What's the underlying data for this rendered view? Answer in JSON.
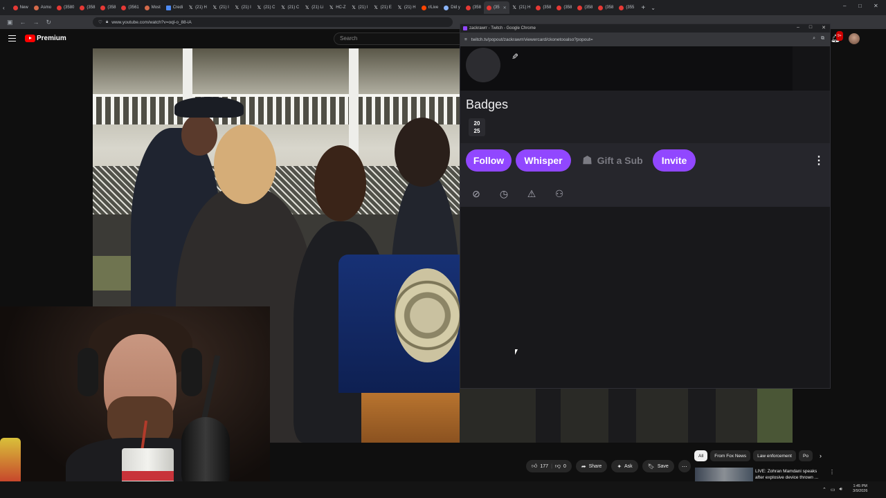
{
  "browser": {
    "tabs": [
      {
        "label": "New",
        "icon": "youtube-icon"
      },
      {
        "label": "Asmo",
        "icon": "channel-icon"
      },
      {
        "label": "(3580",
        "icon": "youtube-icon"
      },
      {
        "label": "(358",
        "icon": "youtube-icon"
      },
      {
        "label": "(358",
        "icon": "youtube-icon"
      },
      {
        "label": "(3561",
        "icon": "youtube-icon"
      },
      {
        "label": "Most",
        "icon": "channel-icon"
      },
      {
        "label": "Credi",
        "icon": "doc-icon"
      },
      {
        "label": "(21) H",
        "icon": "x-icon"
      },
      {
        "label": "(21) I",
        "icon": "x-icon"
      },
      {
        "label": "(21) I",
        "icon": "x-icon"
      },
      {
        "label": "(21) C",
        "icon": "x-icon"
      },
      {
        "label": "(21) C",
        "icon": "x-icon"
      },
      {
        "label": "(21) Li",
        "icon": "x-icon"
      },
      {
        "label": "HC-Z",
        "icon": "x-icon"
      },
      {
        "label": "(21) I",
        "icon": "x-icon"
      },
      {
        "label": "(21) E",
        "icon": "x-icon"
      },
      {
        "label": "(21) H",
        "icon": "x-icon"
      },
      {
        "label": "r/Live",
        "icon": "reddit-icon"
      },
      {
        "label": "Did y",
        "icon": "globe-icon"
      },
      {
        "label": "(358",
        "icon": "youtube-icon"
      },
      {
        "label": "(35",
        "icon": "youtube-icon",
        "active": true
      },
      {
        "label": "(21) H",
        "icon": "x-icon"
      },
      {
        "label": "(358",
        "icon": "youtube-icon"
      },
      {
        "label": "(358",
        "icon": "youtube-icon"
      },
      {
        "label": "(358",
        "icon": "youtube-icon"
      },
      {
        "label": "(358",
        "icon": "youtube-icon"
      },
      {
        "label": "(355",
        "icon": "youtube-icon"
      }
    ],
    "url": "www.youtube.com/watch?v=oql-o_88-iA"
  },
  "youtube": {
    "brand": "Premium",
    "search_placeholder": "Search",
    "notifications_badge": "9+",
    "actions": {
      "like_count": "177",
      "dislike_count": "0",
      "share": "Share",
      "ask": "Ask",
      "save": "Save"
    },
    "chips": [
      "All",
      "From Fox News",
      "Law enforcement",
      "Po"
    ],
    "recommendation": {
      "title": "LIVE: Zohran Mamdani speaks after explosive device thrown ..."
    }
  },
  "popout": {
    "window_title": "zackrawrr - Twitch - Google Chrome",
    "url": "twitch.tv/popout/zackrawrr/viewercard/ckonetooalso?popout=",
    "badges_title": "Badges",
    "badge_text": "20\n25",
    "buttons": {
      "follow": "Follow",
      "whisper": "Whisper",
      "gift": "Gift a Sub",
      "invite": "Invite"
    },
    "accent": "#9147ff"
  },
  "taskbar": {
    "time": "1:45 PM",
    "date": "3/9/2026"
  }
}
